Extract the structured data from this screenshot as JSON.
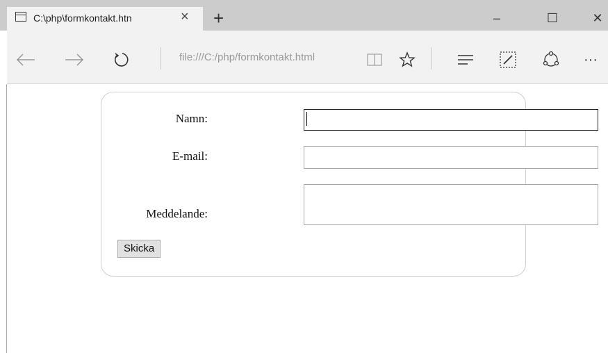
{
  "browser": {
    "tab_title": "C:\\php\\formkontakt.htn",
    "tab_close": "×",
    "new_tab": "+",
    "minimize": "–",
    "maximize": "☐",
    "close": "✕",
    "address": "file:///C:/php/formkontakt.html",
    "more": "···"
  },
  "form": {
    "name_label": "Namn:",
    "email_label": "E-mail:",
    "message_label": "Meddelande:",
    "submit_label": "Skicka",
    "name_value": "",
    "email_value": "",
    "message_value": ""
  }
}
